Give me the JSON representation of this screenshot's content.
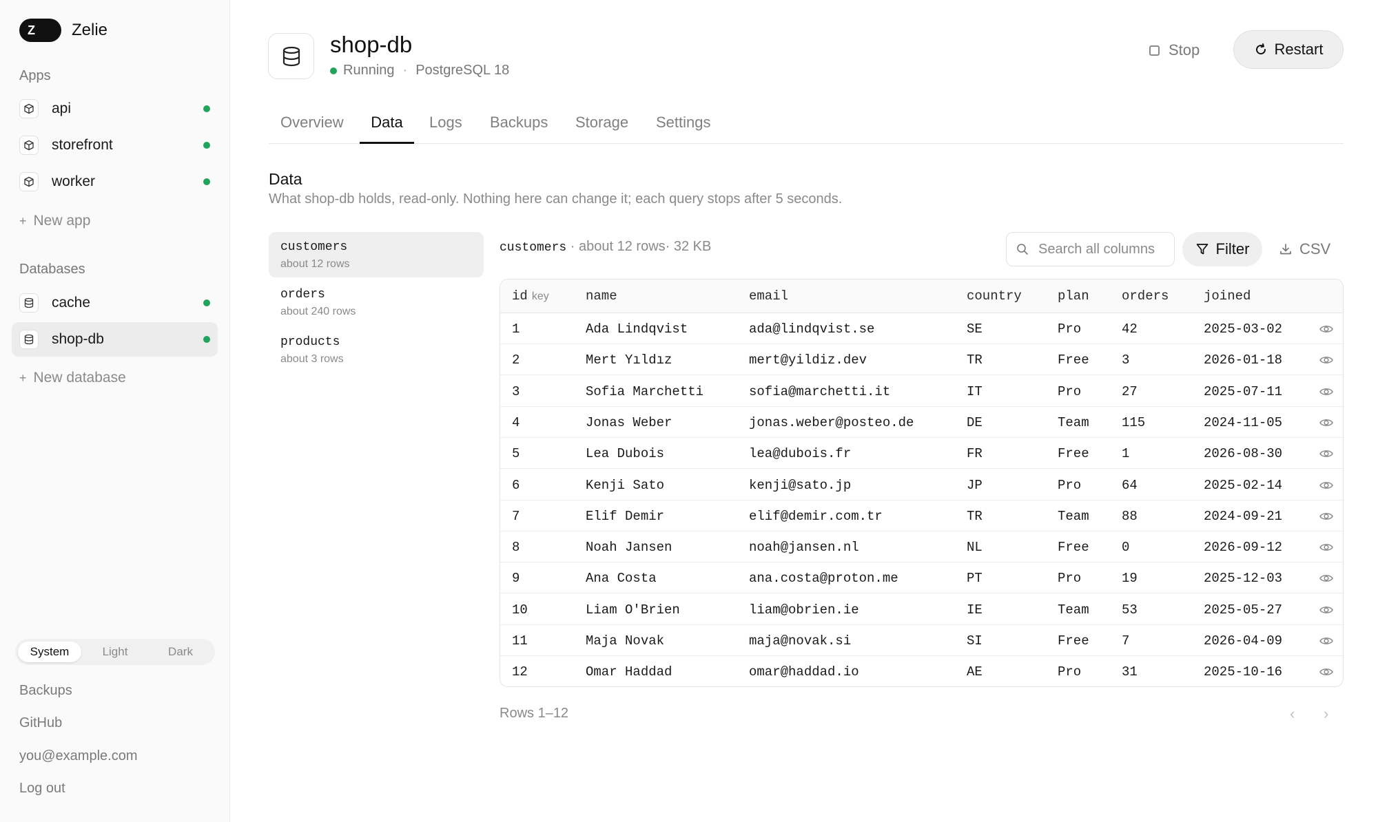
{
  "brand": {
    "initial": "Z",
    "name": "Zelie"
  },
  "sidebar": {
    "apps_label": "Apps",
    "apps": [
      {
        "label": "api",
        "icon": "box-icon",
        "status": "running"
      },
      {
        "label": "storefront",
        "icon": "box-icon",
        "status": "running"
      },
      {
        "label": "worker",
        "icon": "box-icon",
        "status": "running"
      }
    ],
    "new_app": "New app",
    "databases_label": "Databases",
    "databases": [
      {
        "label": "cache",
        "icon": "database-icon",
        "status": "running",
        "active": false
      },
      {
        "label": "shop-db",
        "icon": "database-icon",
        "status": "running",
        "active": true
      }
    ],
    "new_database": "New database",
    "theme": {
      "options": [
        "System",
        "Light",
        "Dark"
      ],
      "selected": "System"
    },
    "footer_links": [
      "Backups",
      "GitHub",
      "you@example.com",
      "Log out"
    ]
  },
  "header": {
    "title": "shop-db",
    "status": "Running",
    "engine": "PostgreSQL 18",
    "stop_label": "Stop",
    "restart_label": "Restart"
  },
  "tabs": [
    {
      "label": "Overview",
      "active": false
    },
    {
      "label": "Data",
      "active": true
    },
    {
      "label": "Logs",
      "active": false
    },
    {
      "label": "Backups",
      "active": false
    },
    {
      "label": "Storage",
      "active": false
    },
    {
      "label": "Settings",
      "active": false
    }
  ],
  "data_section": {
    "title": "Data",
    "description": "What shop-db holds, read-only. Nothing here can change it; each query stops after 5 seconds."
  },
  "tables": [
    {
      "name": "customers",
      "rows": "about 12 rows",
      "active": true
    },
    {
      "name": "orders",
      "rows": "about 240 rows",
      "active": false
    },
    {
      "name": "products",
      "rows": "about 3 rows",
      "active": false
    }
  ],
  "table_view": {
    "name": "customers",
    "meta": "· about 12 rows· 32 KB",
    "search_placeholder": "Search all columns",
    "filter_label": "Filter",
    "csv_label": "CSV",
    "columns": [
      "id",
      "name",
      "email",
      "country",
      "plan",
      "orders",
      "joined"
    ],
    "key_label": "key",
    "rows": [
      [
        "1",
        "Ada Lindqvist",
        "ada@lindqvist.se",
        "SE",
        "Pro",
        "42",
        "2025-03-02"
      ],
      [
        "2",
        "Mert Yıldız",
        "mert@yildiz.dev",
        "TR",
        "Free",
        "3",
        "2026-01-18"
      ],
      [
        "3",
        "Sofia Marchetti",
        "sofia@marchetti.it",
        "IT",
        "Pro",
        "27",
        "2025-07-11"
      ],
      [
        "4",
        "Jonas Weber",
        "jonas.weber@posteo.de",
        "DE",
        "Team",
        "115",
        "2024-11-05"
      ],
      [
        "5",
        "Lea Dubois",
        "lea@dubois.fr",
        "FR",
        "Free",
        "1",
        "2026-08-30"
      ],
      [
        "6",
        "Kenji Sato",
        "kenji@sato.jp",
        "JP",
        "Pro",
        "64",
        "2025-02-14"
      ],
      [
        "7",
        "Elif Demir",
        "elif@demir.com.tr",
        "TR",
        "Team",
        "88",
        "2024-09-21"
      ],
      [
        "8",
        "Noah Jansen",
        "noah@jansen.nl",
        "NL",
        "Free",
        "0",
        "2026-09-12"
      ],
      [
        "9",
        "Ana Costa",
        "ana.costa@proton.me",
        "PT",
        "Pro",
        "19",
        "2025-12-03"
      ],
      [
        "10",
        "Liam O'Brien",
        "liam@obrien.ie",
        "IE",
        "Team",
        "53",
        "2025-05-27"
      ],
      [
        "11",
        "Maja Novak",
        "maja@novak.si",
        "SI",
        "Free",
        "7",
        "2026-04-09"
      ],
      [
        "12",
        "Omar Haddad",
        "omar@haddad.io",
        "AE",
        "Pro",
        "31",
        "2025-10-16"
      ]
    ],
    "rows_label": "Rows 1–12"
  },
  "colors": {
    "status_green": "#22a35a",
    "active_bg": "#ececec"
  }
}
